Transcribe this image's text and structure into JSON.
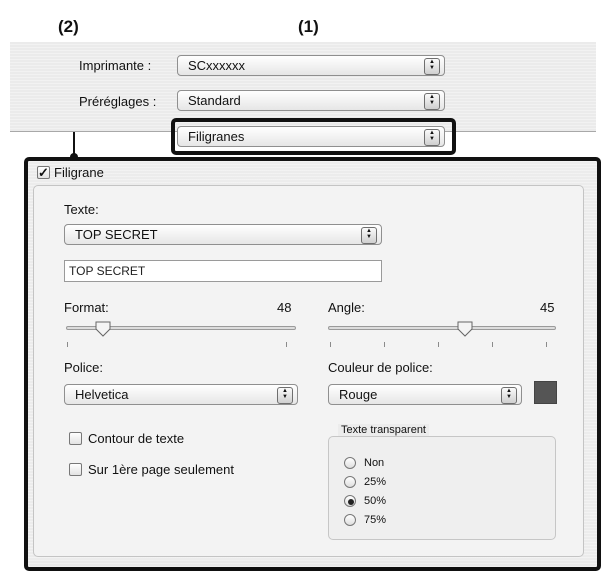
{
  "callouts": {
    "one": "(1)",
    "two": "(2)"
  },
  "printer": {
    "label": "Imprimante :",
    "value": "SCxxxxxx"
  },
  "presets": {
    "label": "Préréglages :",
    "value": "Standard"
  },
  "panel_menu": {
    "value": "Filigranes"
  },
  "watermark": {
    "checkbox_label": "Filigrane",
    "checked": true,
    "text_label": "Texte:",
    "text_select_value": "TOP SECRET",
    "text_field_value": "TOP SECRET",
    "size_label": "Format:",
    "size_value": "48",
    "angle_label": "Angle:",
    "angle_value": "45",
    "font_label": "Police:",
    "font_value": "Helvetica",
    "color_label": "Couleur de police:",
    "color_value": "Rouge",
    "color_swatch": "#555555",
    "outline_label": "Contour de texte",
    "first_page_label": "Sur 1ère page seulement",
    "transparency_title": "Texte transparent",
    "transparency_options": [
      "Non",
      "25%",
      "50%",
      "75%"
    ],
    "transparency_selected": "50%"
  }
}
